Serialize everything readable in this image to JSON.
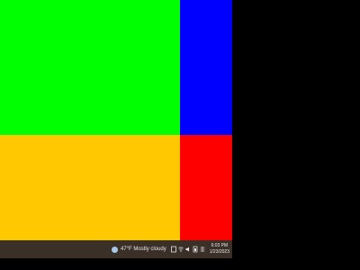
{
  "desktop": {
    "blocks": [
      {
        "name": "green",
        "color": "#00ff00"
      },
      {
        "name": "blue",
        "color": "#0000ff"
      },
      {
        "name": "yellow",
        "color": "#ffc800"
      },
      {
        "name": "red",
        "color": "#ff0000"
      }
    ]
  },
  "taskbar": {
    "weather": {
      "icon": "weather-cloud-icon",
      "text": "47°F Mostly cloudy"
    },
    "tray_icons": [
      "system-tray-icon",
      "network-icon",
      "volume-icon",
      "battery-icon",
      "input-icon"
    ],
    "clock": {
      "time": "6:03 PM",
      "date": "1/23/2023"
    }
  }
}
